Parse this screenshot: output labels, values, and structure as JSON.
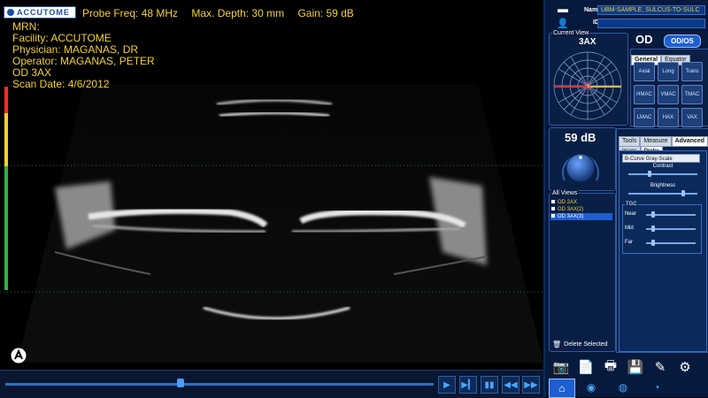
{
  "header": {
    "brand": "ACCUTOME",
    "probe_freq": "Probe Freq: 48 MHz",
    "max_depth": "Max. Depth: 30 mm",
    "gain": "Gain: 59 dB"
  },
  "patient": {
    "mrn": "MRN:",
    "facility": "Facility: ACCUTOME",
    "physician": "Physician: MAGANAS, DR",
    "operator": "Operator: MAGANAS, PETER",
    "eye_view": "OD 3AX",
    "scan_date": "Scan Date: 4/6/2012"
  },
  "right_panel": {
    "name_label": "Name",
    "name_value": "UBM-SAMPLE, SULCUS-TO-SULC",
    "id_label": "ID",
    "id_value": "",
    "current_view_label": "Current View",
    "current_view": "3AX",
    "eye": "OD",
    "eye_toggle": "OD/OS",
    "view_tabs": [
      "General",
      "Equator"
    ],
    "view_buttons": [
      "Axial",
      "Long",
      "Trans",
      "HMAC",
      "VMAC",
      "TMAC",
      "LMAC",
      "HAX",
      "VAX"
    ],
    "gain_display": "59 dB",
    "all_views_label": "All Views",
    "all_views": [
      "OD 2AX",
      "OD 3AX(2)",
      "OD 3AX(3)"
    ],
    "delete_selected": "Delete Selected",
    "tool_tabs": [
      "Tools",
      "Measure",
      "Advanced"
    ],
    "sub_tabs": [
      "Image",
      "Probe"
    ],
    "grayscale_select": "B-Curve Gray-Scale",
    "contrast_label": "Contrast",
    "brightness_label": "Brightness",
    "tgc_label": "TGC",
    "tgc_near": "Near",
    "tgc_mid": "Mid",
    "tgc_far": "Far"
  },
  "icons": {
    "folder": "folder-icon",
    "add_patient": "add-user-icon",
    "camera": "camera-icon",
    "document": "document-icon",
    "print": "printer-icon",
    "save": "floppy-icon",
    "pen": "pen-icon",
    "settings": "gear-icon",
    "home": "home-icon"
  },
  "colors": {
    "accent_yellow": "#f2d22e",
    "panel_blue": "#071a3d",
    "highlight_blue": "#1e5fd0"
  }
}
